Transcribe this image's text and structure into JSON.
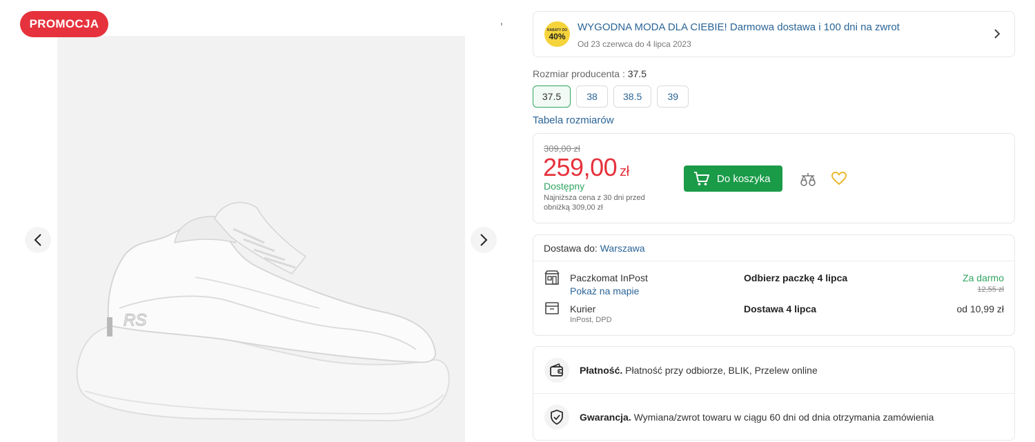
{
  "gallery": {
    "badge": "PROMOCJA",
    "image_alt": "white sneaker"
  },
  "promo": {
    "badge_small": "RABATY DO",
    "badge_big": "40%",
    "title": "WYGODNA MODA DLA CIEBIE! Darmowa dostawa i 100 dni na zwrot",
    "dates": "Od 23 czerwca do 4 lipca 2023"
  },
  "size": {
    "label": "Rozmiar producenta",
    "selected": "37.5",
    "options": [
      "37.5",
      "38",
      "38.5",
      "39"
    ],
    "table_link": "Tabela rozmiarów"
  },
  "price": {
    "old": "309,00 zł",
    "new": "259,00",
    "currency": "zł",
    "availability": "Dostępny",
    "lowest_note": "Najniższa cena z 30 dni przed obniżką 309,00 zł",
    "add_to_cart": "Do koszyka"
  },
  "delivery": {
    "label": "Dostawa do:",
    "city": "Warszawa",
    "options": [
      {
        "name": "Paczkomat InPost",
        "sub": "Pokaż na mapie",
        "date": "Odbierz paczkę 4 lipca",
        "price": "Za darmo",
        "old_price": "12,55 zł"
      },
      {
        "name": "Kurier",
        "sub": "InPost, DPD",
        "date": "Dostawa 4 lipca",
        "price": "od 10,99 zł"
      }
    ]
  },
  "info": {
    "payment_title": "Płatność.",
    "payment_text": "Płatność przy odbiorze, BLIK, Przelew online",
    "warranty_title": "Gwarancja.",
    "warranty_text": "Wymiana/zwrot towaru w ciągu 60 dni od dnia otrzymania zamówienia"
  },
  "icons": {
    "prev": "chevron-left-icon",
    "next": "chevron-right-icon",
    "cart": "cart-icon",
    "compare": "compare-scale-icon",
    "wishlist": "heart-icon",
    "paczkomat": "parcel-locker-icon",
    "courier": "package-box-icon",
    "payment": "wallet-icon",
    "warranty": "shield-check-icon"
  },
  "colors": {
    "accent_red": "#e6323c",
    "accent_green": "#1a9b48",
    "link_blue": "#2a6496",
    "wishlist_yellow": "#e8b931"
  }
}
